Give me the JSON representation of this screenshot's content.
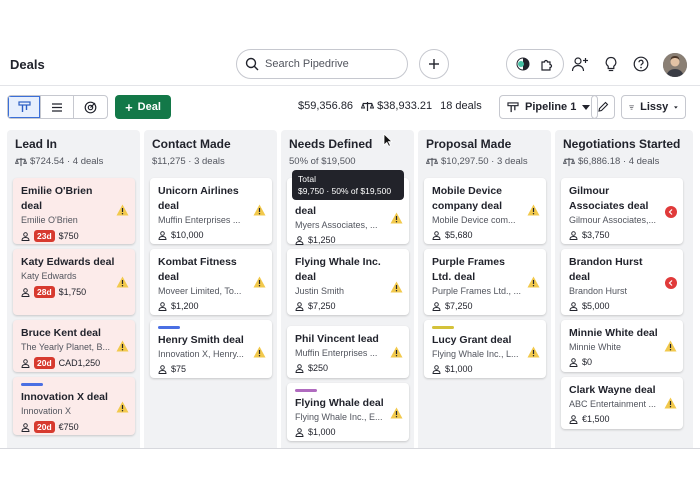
{
  "app": {
    "title": "Deals"
  },
  "search": {
    "placeholder": "Search Pipedrive"
  },
  "toolbar": {
    "add_deal_label": "Deal",
    "total_value": "$59,356.86",
    "weighted_value": "$38,933.21",
    "deal_count": "18 deals",
    "pipeline_label": "Pipeline 1",
    "user_filter_label": "Lissy"
  },
  "tooltip": {
    "title": "Total",
    "body": "$9,750 · 50% of $19,500"
  },
  "colors": {
    "primary": "#137848",
    "rotten_bg": "#fcebea",
    "days_badge": "#d73a2f",
    "warning": "#f2c94c"
  },
  "stages": [
    {
      "name": "Lead In",
      "summary": "$724.54 · 4 deals",
      "cards": [
        {
          "title": "Emilie O'Brien deal",
          "org": "Emilie O'Brien",
          "days": "23d",
          "value": "$750"
        },
        {
          "title": "Katy Edwards deal",
          "org": "Katy Edwards",
          "days": "28d",
          "value": "$1,750"
        },
        {
          "title": "Bruce Kent deal",
          "org": "The Yearly Planet, B...",
          "days": "20d",
          "value": "CAD1,250"
        },
        {
          "title": "Innovation X deal",
          "org": "Innovation X",
          "days": "20d",
          "value": "€750"
        }
      ]
    },
    {
      "name": "Contact Made",
      "summary": "$11,275 · 3 deals",
      "cards": [
        {
          "title": "Unicorn Airlines deal",
          "org": "Muffin Enterprises ...",
          "value": "$10,000"
        },
        {
          "title": "Kombat Fitness deal",
          "org": "Moveer Limited, To...",
          "value": "$1,200"
        },
        {
          "title": "Henry Smith deal",
          "org": "Innovation X, Henry...",
          "value": "$75"
        }
      ]
    },
    {
      "name": "Needs Defined",
      "summary": "50% of $19,500",
      "cards": [
        {
          "title": "deal",
          "org": "Myers Associates, ...",
          "value": "$1,250"
        },
        {
          "title": "Flying Whale Inc. deal",
          "org": "Justin Smith",
          "value": "$7,250"
        },
        {
          "title": "Phil Vincent lead",
          "org": "Muffin Enterprises ...",
          "value": "$250"
        },
        {
          "title": "Flying Whale deal",
          "org": "Flying Whale Inc., E...",
          "value": "$1,000"
        }
      ]
    },
    {
      "name": "Proposal Made",
      "summary": "$10,297.50 · 3 deals",
      "cards": [
        {
          "title": "Mobile Device company deal",
          "org": "Mobile Device com...",
          "value": "$5,680"
        },
        {
          "title": "Purple Frames Ltd. deal",
          "org": "Purple Frames Ltd., ...",
          "value": "$7,250"
        },
        {
          "title": "Lucy Grant deal",
          "org": "Flying Whale Inc., L...",
          "value": "$1,000"
        }
      ]
    },
    {
      "name": "Negotiations Started",
      "summary": "$6,886.18 · 4 deals",
      "cards": [
        {
          "title": "Gilmour Associates deal",
          "org": "Gilmour Associates,...",
          "value": "$3,750"
        },
        {
          "title": "Brandon Hurst deal",
          "org": "Brandon Hurst",
          "value": "$5,000"
        },
        {
          "title": "Minnie White deal",
          "org": "Minnie White",
          "value": "$0"
        },
        {
          "title": "Clark Wayne deal",
          "org": "ABC Entertainment ...",
          "value": "€1,500"
        }
      ]
    }
  ]
}
